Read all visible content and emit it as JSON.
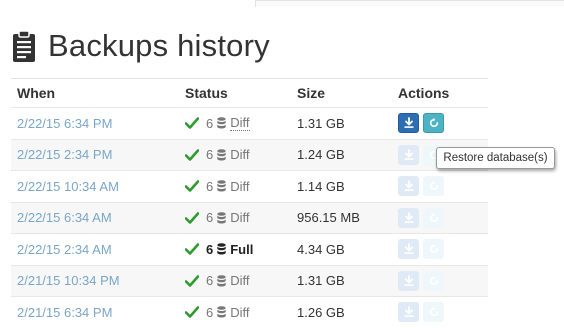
{
  "page": {
    "title": "Backups history",
    "title_icon": "clipboard-icon"
  },
  "table": {
    "headers": {
      "when": "When",
      "status": "Status",
      "size": "Size",
      "actions": "Actions"
    },
    "rows": [
      {
        "when": "2/22/15 6:34 PM",
        "count": "6",
        "type": "Diff",
        "size": "1.31 GB",
        "active": true
      },
      {
        "when": "2/22/15 2:34 PM",
        "count": "6",
        "type": "Diff",
        "size": "1.24 GB"
      },
      {
        "when": "2/22/15 10:34 AM",
        "count": "6",
        "type": "Diff",
        "size": "1.14 GB"
      },
      {
        "when": "2/22/15 6:34 AM",
        "count": "6",
        "type": "Diff",
        "size": "956.15 MB"
      },
      {
        "when": "2/22/15 2:34 AM",
        "count": "6",
        "type": "Full",
        "size": "4.34 GB"
      },
      {
        "when": "2/21/15 10:34 PM",
        "count": "6",
        "type": "Diff",
        "size": "1.31 GB"
      },
      {
        "when": "2/21/15 6:34 PM",
        "count": "6",
        "type": "Diff",
        "size": "1.26 GB"
      }
    ]
  },
  "tooltip": {
    "text": "Restore database(s)"
  },
  "colors": {
    "link": "#7aa6c8",
    "check": "#2e9b2e",
    "download_button": "#2d6db3",
    "restore_button": "#4bb3c4"
  }
}
